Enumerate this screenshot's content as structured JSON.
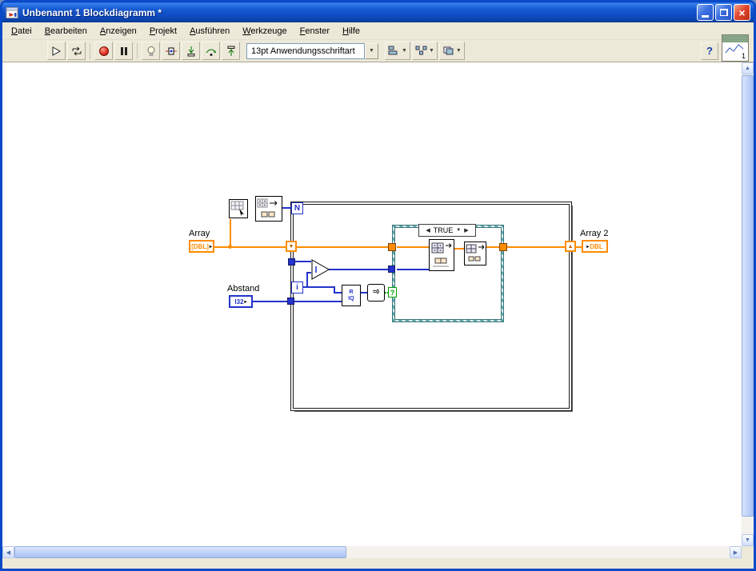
{
  "window": {
    "title": "Unbenannt 1 Blockdiagramm *"
  },
  "icons": {
    "close": "×",
    "dropdown_small": "▼",
    "scroll_up": "▲",
    "scroll_down": "▼",
    "scroll_left": "◀",
    "scroll_right": "▶",
    "shift_left": "▼",
    "shift_right": "▲",
    "terminal_arrow": "▸",
    "case_prev": "◀",
    "case_next": "▶",
    "case_dropdown": "▼"
  },
  "menu": {
    "items": [
      {
        "label": "Datei"
      },
      {
        "label": "Bearbeiten"
      },
      {
        "label": "Anzeigen"
      },
      {
        "label": "Projekt"
      },
      {
        "label": "Ausführen"
      },
      {
        "label": "Werkzeuge"
      },
      {
        "label": "Fenster"
      },
      {
        "label": "Hilfe"
      }
    ]
  },
  "toolbar": {
    "font_selector_value": "13pt Anwendungsschriftart",
    "help_label": "?",
    "vi_icon_badge": "1"
  },
  "diagram": {
    "array_control": {
      "label": "Array",
      "type_text": "[DBL]"
    },
    "abstand_control": {
      "label": "Abstand",
      "type_text": "I32"
    },
    "array2_indicator": {
      "label": "Array 2",
      "type_text": "DBL"
    },
    "for_loop": {
      "count_label": "N",
      "iteration_label": "i"
    },
    "case_structure": {
      "selector_value": "TRUE",
      "selector_terminal": "?"
    },
    "functions": {
      "quotient_top": "R",
      "quotient_bottom": "IQ",
      "equal_zero": "=0"
    }
  },
  "colors": {
    "wire_orange": "#ff8c00",
    "wire_blue": "#2333cc",
    "boolean_green": "#00a000",
    "case_teal": "#5fa8ac",
    "titlebar_blue": "#0a49c8",
    "chrome": "#ece9d8",
    "canvas": "#ffffff"
  }
}
